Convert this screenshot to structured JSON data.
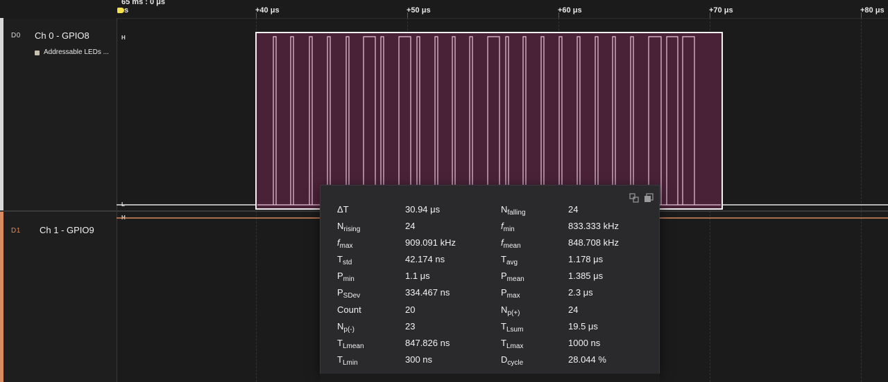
{
  "ruler": {
    "cursor_time": "65 ms : 0 μs",
    "cursor_fragment": "s",
    "ticks": [
      "+40 μs",
      "+50 μs",
      "+60 μs",
      "+70 μs",
      "+80 μs"
    ]
  },
  "channels": [
    {
      "id": "D0",
      "name": "Ch 0 - GPIO8",
      "color": "#d8d8d8",
      "analyzer": "Addressable LEDs ..."
    },
    {
      "id": "D1",
      "name": "Ch 1 - GPIO9",
      "color": "#d98c5f"
    }
  ],
  "levels": {
    "high": "H",
    "low": "L"
  },
  "trace_colors": {
    "selection_fill": "#4a2238",
    "pulse_line": "#e9c7df",
    "d1_line": "#d98c5f"
  },
  "measurements": {
    "delta_t": {
      "label": "ΔT",
      "value": "30.94 μs"
    },
    "n_falling": {
      "label": "N",
      "sub": "falling",
      "value": "24"
    },
    "n_rising": {
      "label": "N",
      "sub": "rising",
      "value": "24"
    },
    "f_min": {
      "label": "f",
      "sub": "min",
      "value": "833.333 kHz"
    },
    "f_max": {
      "label": "f",
      "sub": "max",
      "value": "909.091 kHz"
    },
    "f_mean": {
      "label": "f",
      "sub": "mean",
      "value": "848.708 kHz"
    },
    "t_std": {
      "label": "T",
      "sub": "std",
      "value": "42.174 ns"
    },
    "t_avg": {
      "label": "T",
      "sub": "avg",
      "value": "1.178 μs"
    },
    "p_min": {
      "label": "P",
      "sub": "min",
      "value": "1.1 μs"
    },
    "p_mean": {
      "label": "P",
      "sub": "mean",
      "value": "1.385 μs"
    },
    "p_sdev": {
      "label": "P",
      "sub": "SDev",
      "value": "334.467 ns"
    },
    "p_max": {
      "label": "P",
      "sub": "max",
      "value": "2.3 μs"
    },
    "count": {
      "label": "Count",
      "value": "20"
    },
    "np_plus": {
      "label": "N",
      "sub": "p(+)",
      "value": "24"
    },
    "np_minus": {
      "label": "N",
      "sub": "p(-)",
      "value": "23"
    },
    "tl_sum": {
      "label": "T",
      "sub": "Lsum",
      "value": "19.5 μs"
    },
    "tl_mean": {
      "label": "T",
      "sub": "Lmean",
      "value": "847.826 ns"
    },
    "tl_max": {
      "label": "T",
      "sub": "Lmax",
      "value": "1000 ns"
    },
    "tl_min": {
      "label": "T",
      "sub": "Lmin",
      "value": "300 ns"
    },
    "d_cycle": {
      "label": "D",
      "sub": "cycle",
      "value": "28.044 %"
    }
  },
  "icons": [
    "expand-panel-icon",
    "copy-icon"
  ]
}
